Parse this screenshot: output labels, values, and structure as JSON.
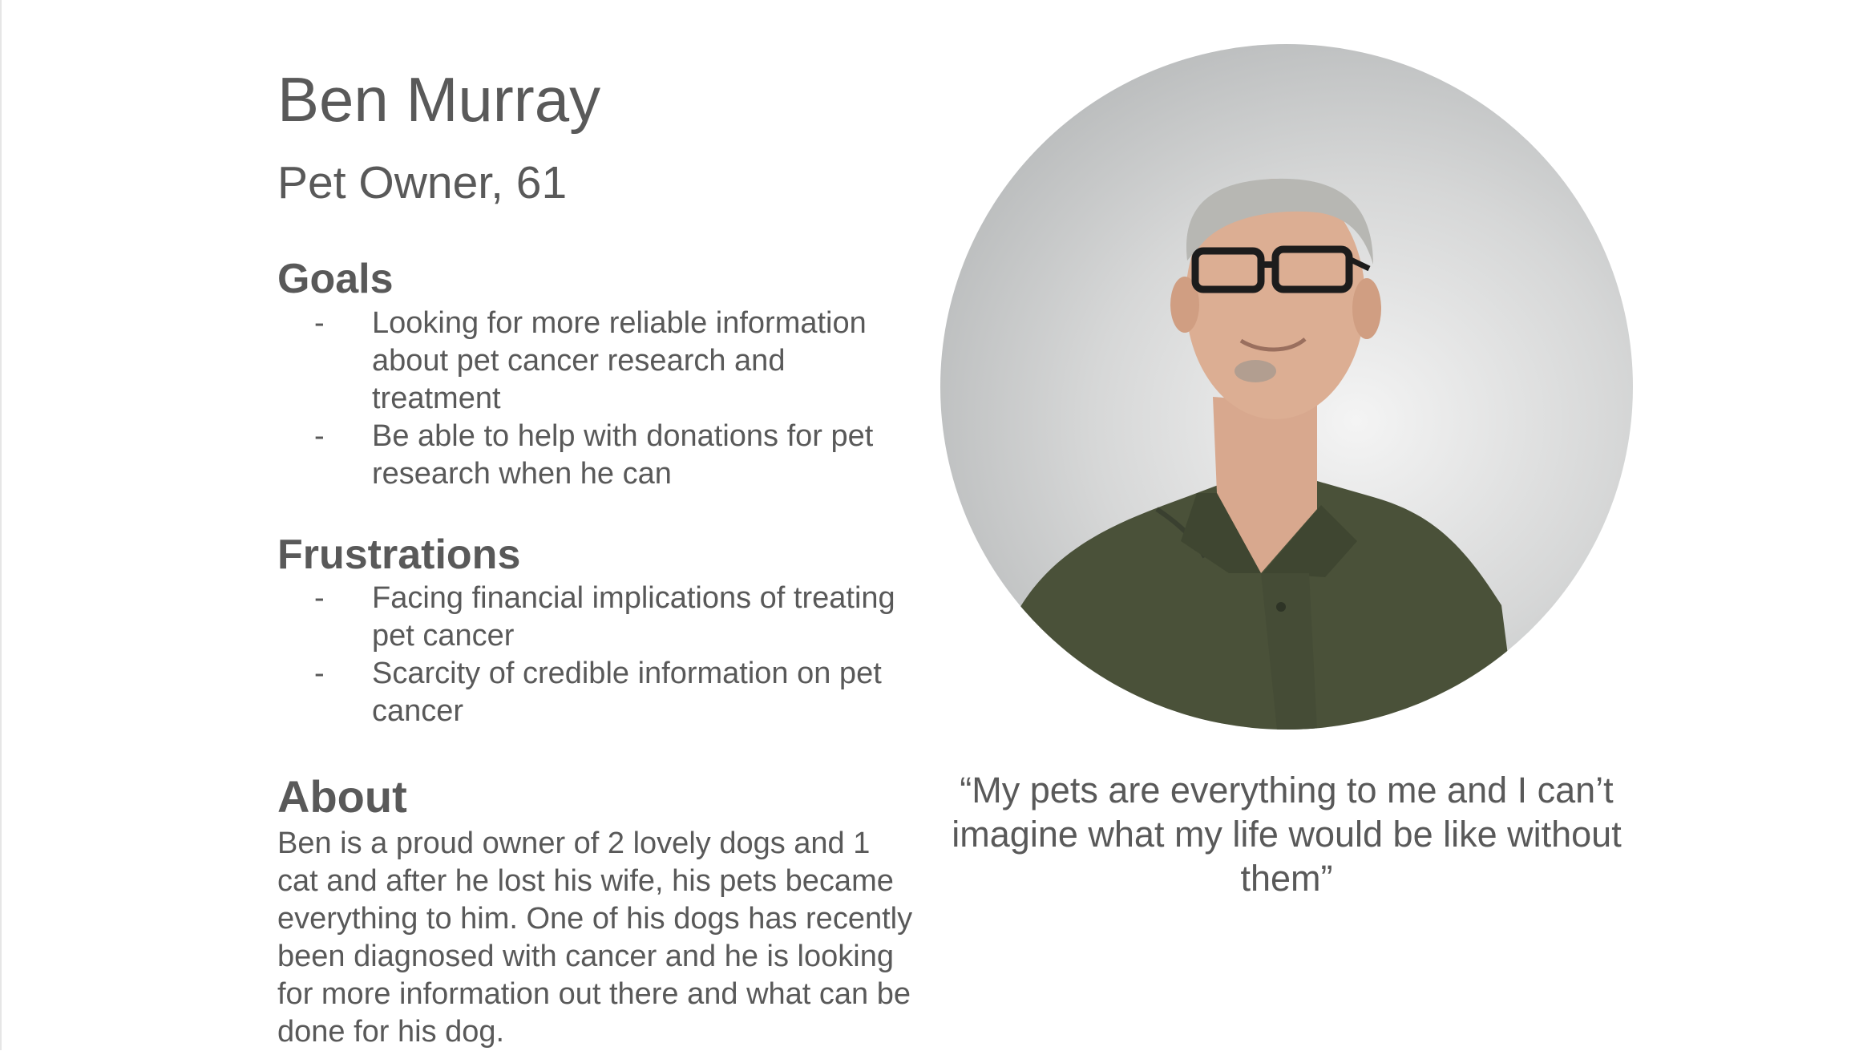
{
  "persona": {
    "name": "Ben Murray",
    "role": "Pet Owner, 61"
  },
  "goals": {
    "title": "Goals",
    "items": [
      "Looking for more reliable information about pet cancer research and treatment",
      "Be able to help with donations for pet research when he can"
    ]
  },
  "frustrations": {
    "title": "Frustrations",
    "items": [
      "Facing financial implications of treating pet cancer",
      "Scarcity of credible information on pet cancer"
    ]
  },
  "about": {
    "title": "About",
    "text": "Ben is a proud owner of 2 lovely dogs and 1 cat and after he lost his wife, his pets became everything to him. One of his dogs has recently been diagnosed with cancer and he is looking for more information out there and what can be done for his dog."
  },
  "quote": "“My pets are everything to me and I can’t imagine what my life would be like without them”",
  "bullet_marker": "-",
  "colors": {
    "text": "#595959",
    "shirt": "#4a5139",
    "background": "#ffffff"
  }
}
